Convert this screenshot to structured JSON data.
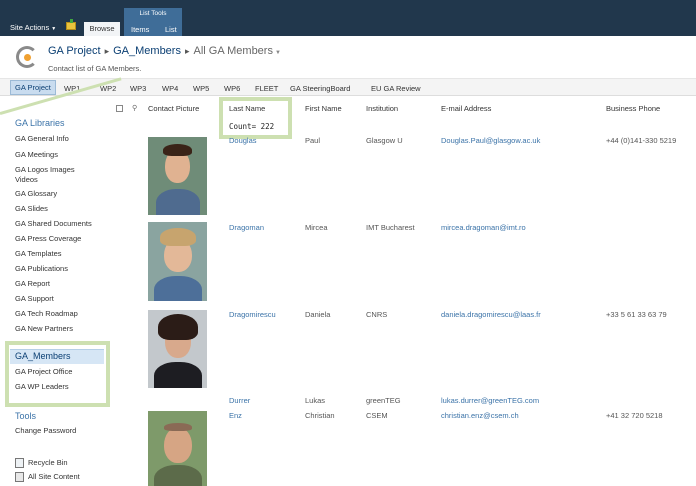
{
  "ribbon": {
    "site_actions": "Site Actions",
    "contextual_group": "List Tools",
    "tabs": [
      "Browse",
      "Items",
      "List"
    ]
  },
  "title": {
    "site": "GA Project",
    "list": "GA_Members",
    "view": "All GA Members",
    "description": "Contact list of GA Members."
  },
  "topnav": [
    "GA Project",
    "WP1",
    "WP2",
    "WP3",
    "WP4",
    "WP5",
    "WP6",
    "FLEET",
    "GA SteeringBoard",
    "EU GA Review"
  ],
  "quicklaunch": {
    "libraries_heading": "GA Libraries",
    "libraries": [
      "GA General Info",
      "GA Meetings",
      "GA Logos Images",
      "Videos",
      "GA Glossary",
      "GA Slides",
      "GA Shared Documents",
      "GA Press Coverage",
      "GA Templates",
      "GA Publications",
      "GA Report",
      "GA Support",
      "GA Tech Roadmap",
      "GA New Partners"
    ],
    "lists_heading": "GA_Members",
    "lists": [
      "GA Project Office",
      "GA WP Leaders"
    ],
    "tools_heading": "Tools",
    "tools": [
      "Change Password"
    ],
    "recycle_bin": "Recycle Bin",
    "all_site_content": "All Site Content"
  },
  "list": {
    "columns": {
      "picture": "Contact Picture",
      "last_name": "Last Name",
      "first_name": "First Name",
      "institution": "Institution",
      "email": "E-mail Address",
      "phone": "Business Phone"
    },
    "count_label": "Count= 222",
    "rows": [
      {
        "last": "Douglas",
        "first": "Paul",
        "institution": "Glasgow U",
        "email": "Douglas.Paul@glasgow.ac.uk",
        "phone": "+44 (0)141-330 5219"
      },
      {
        "last": "Dragoman",
        "first": "Mircea",
        "institution": "IMT Bucharest",
        "email": "mircea.dragoman@imt.ro",
        "phone": ""
      },
      {
        "last": "Dragomirescu",
        "first": "Daniela",
        "institution": "CNRS",
        "email": "daniela.dragomirescu@laas.fr",
        "phone": "+33 5 61 33 63 79"
      },
      {
        "last": "Durrer",
        "first": "Lukas",
        "institution": "greenTEG",
        "email": "lukas.durrer@greenTEG.com",
        "phone": ""
      },
      {
        "last": "Enz",
        "first": "Christian",
        "institution": "CSEM",
        "email": "christian.enz@csem.ch",
        "phone": "+41 32 720 5218"
      }
    ]
  },
  "colors": {
    "ribbon": "#21374c",
    "link": "#3b73a8",
    "highlight": "#cde0b1"
  }
}
